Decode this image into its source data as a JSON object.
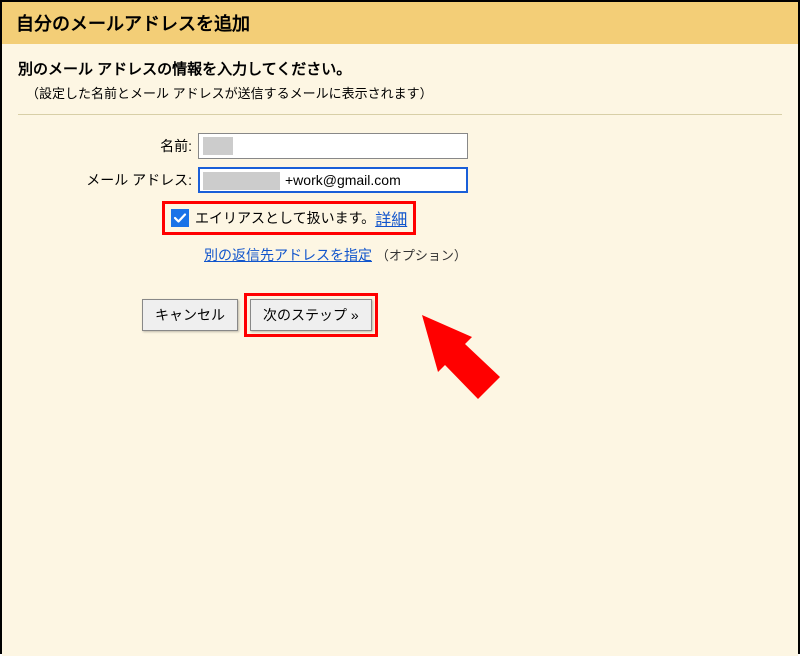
{
  "header": {
    "title": "自分のメールアドレスを追加"
  },
  "prompt": "別のメール アドレスの情報を入力してください。",
  "note": "（設定した名前とメール アドレスが送信するメールに表示されます）",
  "form": {
    "name_label": "名前:",
    "name_value": "",
    "email_label": "メール アドレス:",
    "email_value": "+work@gmail.com",
    "alias_label": "エイリアスとして扱います。",
    "alias_detail": "詳細",
    "reply_link": "別の返信先アドレスを指定",
    "reply_option": "（オプション）"
  },
  "buttons": {
    "cancel": "キャンセル",
    "next": "次のステップ »"
  }
}
